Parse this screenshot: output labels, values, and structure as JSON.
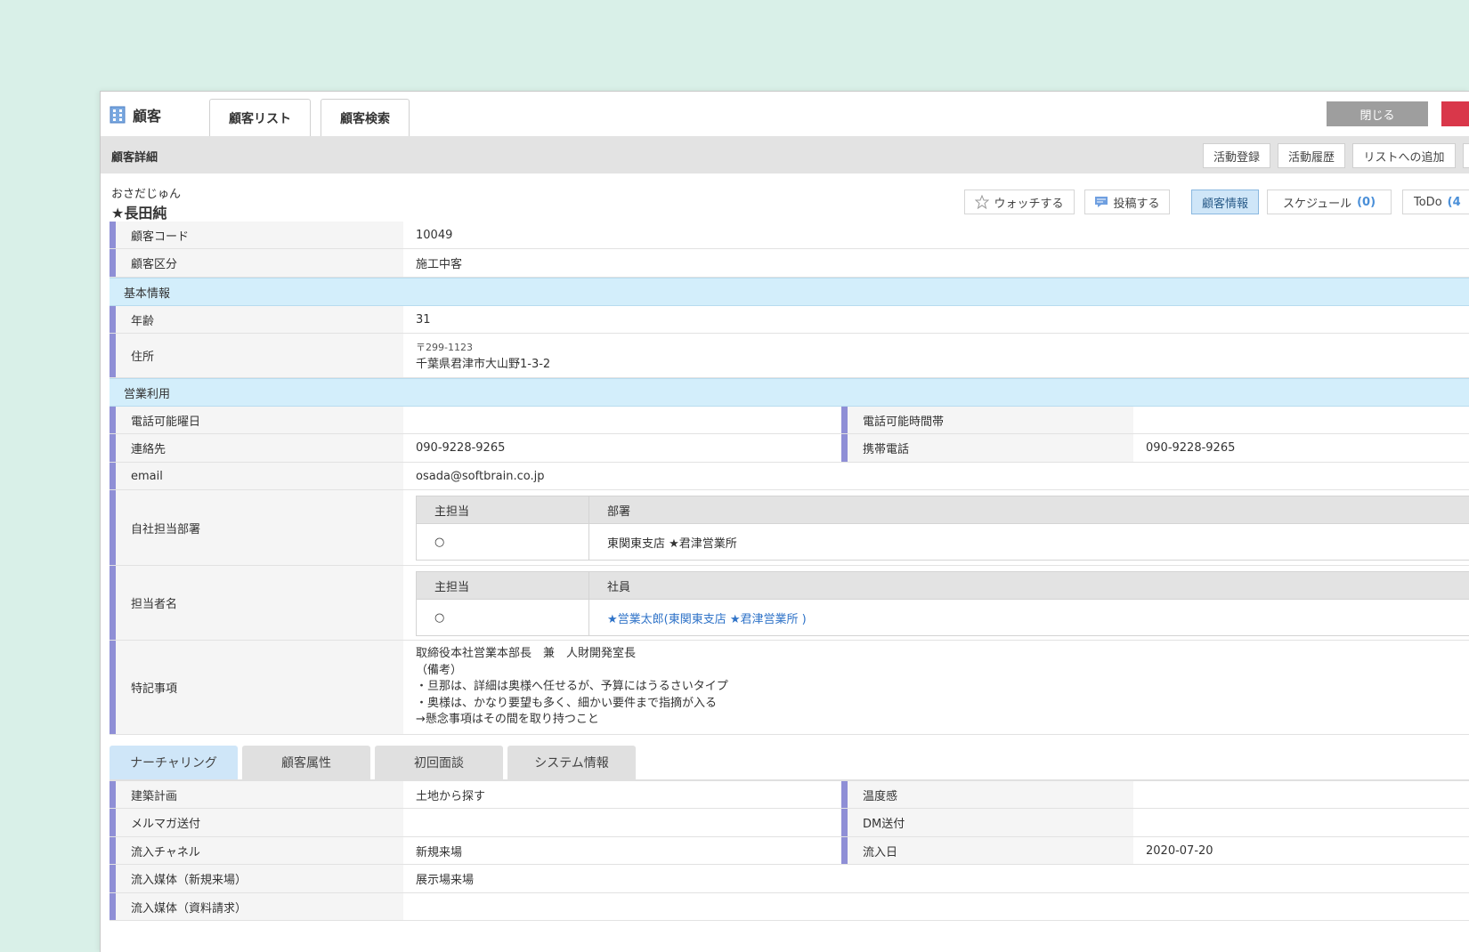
{
  "app": {
    "title": "顧客",
    "tabs": [
      "顧客リスト",
      "顧客検索"
    ],
    "close_label": "閉じる"
  },
  "section": {
    "title": "顧客詳細",
    "actions": [
      "活動登録",
      "活動履歴",
      "リストへの追加"
    ]
  },
  "customer": {
    "kana": "おさだじゅん",
    "name": "★長田純"
  },
  "header_buttons": {
    "watch": "ウォッチする",
    "post": "投稿する",
    "info": "顧客情報",
    "schedule": "スケジュール",
    "schedule_count": "(0)",
    "todo": "ToDo",
    "todo_count": "(4"
  },
  "fields": {
    "code_label": "顧客コード",
    "code": "10049",
    "type_label": "顧客区分",
    "type": "施工中客",
    "group_basic": "基本情報",
    "age_label": "年齢",
    "age": "31",
    "address_label": "住所",
    "zip": "〒299-1123",
    "address": "千葉県君津市大山野1-3-2",
    "group_sales": "営業利用",
    "call_day_label": "電話可能曜日",
    "call_day": "",
    "call_time_label": "電話可能時間帯",
    "call_time": "",
    "contact_label": "連絡先",
    "contact": "090-9228-9265",
    "mobile_label": "携帯電話",
    "mobile": "090-9228-9265",
    "email_label": "email",
    "email": "osada@softbrain.co.jp",
    "dept_label": "自社担当部署",
    "dept_head_main": "主担当",
    "dept_head_dept": "部署",
    "dept_main": "○",
    "dept_value": "東関東支店 ★君津営業所",
    "staff_label": "担当者名",
    "staff_head_main": "主担当",
    "staff_head_staff": "社員",
    "staff_main": "○",
    "staff_value": "★営業太郎(東関東支店 ★君津営業所 )",
    "notes_label": "特記事項",
    "notes": [
      "取締役本社営業本部長　兼　人財開発室長",
      "（備考）",
      "・旦那は、詳細は奥様へ任せるが、予算にはうるさいタイプ",
      "・奥様は、かなり要望も多く、細かい要件まで指摘が入る",
      "→懸念事項はその間を取り持つこと"
    ]
  },
  "bottom_tabs": [
    "ナーチャリング",
    "顧客属性",
    "初回面談",
    "システム情報"
  ],
  "nurture": {
    "plan_label": "建築計画",
    "plan": "土地から探す",
    "temp_label": "温度感",
    "temp": "",
    "mail_label": "メルマガ送付",
    "mail": "",
    "dm_label": "DM送付",
    "dm": "",
    "channel_label": "流入チャネル",
    "channel": "新規来場",
    "date_label": "流入日",
    "date": "2020-07-20",
    "media_label": "流入媒体（新規来場）",
    "media": "展示場来場",
    "media2_label": "流入媒体（資料請求）"
  },
  "colors": {
    "background": "#d9f0e8",
    "accent_bar": "#8f8fd6",
    "group_row": "#d3eefb",
    "active_tab": "#cfe6f8",
    "close_button": "#9e9e9e",
    "red_button": "#d9374a",
    "link": "#2f73c8",
    "count": "#4a8fd8"
  }
}
